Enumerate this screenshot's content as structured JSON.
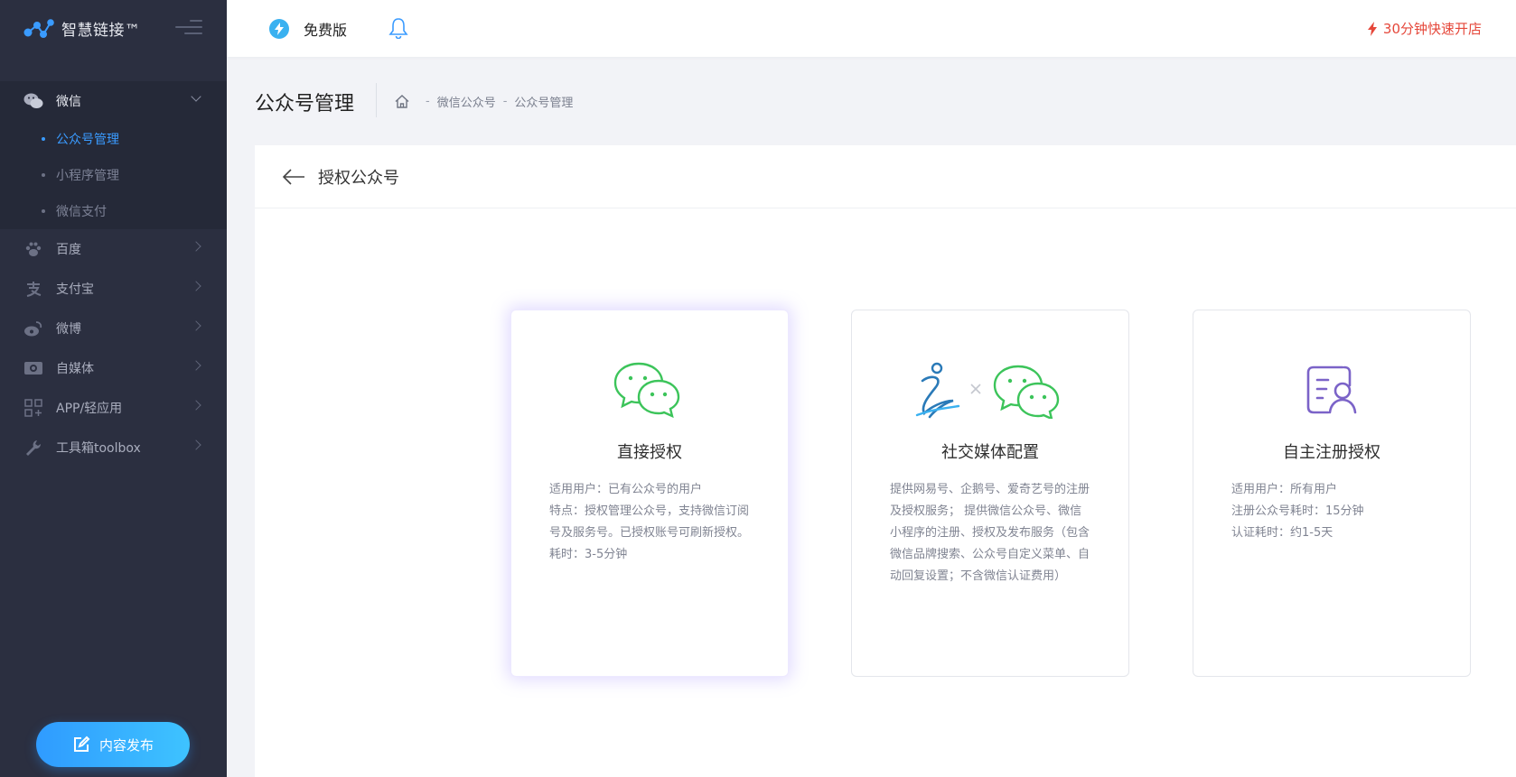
{
  "brand": {
    "name": "智慧链接™"
  },
  "sidebar": {
    "items": [
      {
        "label": "微信",
        "icon": "wechat-icon",
        "open": true,
        "children": [
          {
            "label": "公众号管理",
            "active": true
          },
          {
            "label": "小程序管理",
            "active": false
          },
          {
            "label": "微信支付",
            "active": false
          }
        ]
      },
      {
        "label": "百度",
        "icon": "paw-icon"
      },
      {
        "label": "支付宝",
        "icon": "alipay-icon"
      },
      {
        "label": "微博",
        "icon": "weibo-icon"
      },
      {
        "label": "自媒体",
        "icon": "media-icon"
      },
      {
        "label": "APP/轻应用",
        "icon": "app-grid-icon"
      },
      {
        "label": "工具箱toolbox",
        "icon": "wrench-icon"
      }
    ],
    "publish_label": "内容发布"
  },
  "topbar": {
    "plan_label": "免费版",
    "quick_open_label": "30分钟快速开店"
  },
  "page": {
    "title": "公众号管理",
    "breadcrumb": [
      "微信公众号",
      "公众号管理"
    ]
  },
  "card": {
    "title": "授权公众号",
    "options": [
      {
        "title": "直接授权",
        "selected": true,
        "desc": [
          "适用用户：已有公众号的用户",
          "特点：授权管理公众号，支持微信订阅号及服务号。已授权账号可刷新授权。",
          "耗时：3-5分钟"
        ]
      },
      {
        "title": "社交媒体配置",
        "selected": false,
        "desc": [
          "提供网易号、企鹅号、爱奇艺号的注册及授权服务； 提供微信公众号、微信小程序的注册、授权及发布服务（包含微信品牌搜索、公众号自定义菜单、自动回复设置；不含微信认证费用）"
        ]
      },
      {
        "title": "自主注册授权",
        "selected": false,
        "desc": [
          "适用用户：所有用户",
          "注册公众号耗时：15分钟",
          "认证耗时：约1-5天"
        ]
      }
    ]
  },
  "colors": {
    "accent": "#3a9bff",
    "sidebar_bg": "#2b2f40",
    "wechat_green": "#3cc45a",
    "alert_red": "#e5473a",
    "purple": "#7b63c8"
  }
}
